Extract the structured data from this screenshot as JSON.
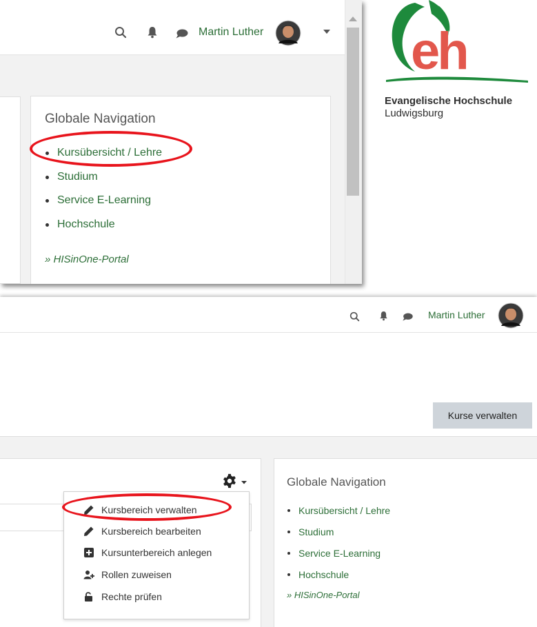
{
  "top_panel": {
    "navbar": {
      "search_icon": "search-icon",
      "notification_icon": "bell-icon",
      "message_icon": "chat-icon",
      "user_name": "Martin Luther",
      "dropdown_icon": "caret-down-icon"
    },
    "global_nav": {
      "title": "Globale Navigation",
      "items": [
        "Kursübersicht / Lehre",
        "Studium",
        "Service E-Learning",
        "Hochschule"
      ],
      "portal_link": "» HISinOne-Portal"
    }
  },
  "logo": {
    "mark_text": "eh",
    "line1": "Evangelische Hochschule",
    "line2": "Ludwigsburg",
    "colors": {
      "green": "#1e8a3c",
      "red": "#e2574c"
    }
  },
  "bottom_panel": {
    "navbar": {
      "search_icon": "search-icon",
      "notification_icon": "bell-icon",
      "message_icon": "chat-icon",
      "user_name": "Martin Luther"
    },
    "manage_courses_button": "Kurse verwalten",
    "settings_menu": {
      "icon": "gear-icon",
      "items": [
        {
          "label": "Kursbereich verwalten",
          "icon": "pencil-icon"
        },
        {
          "label": "Kursbereich bearbeiten",
          "icon": "pencil-icon"
        },
        {
          "label": "Kursunterbereich anlegen",
          "icon": "plus-square-icon"
        },
        {
          "label": "Rollen zuweisen",
          "icon": "user-plus-icon"
        },
        {
          "label": "Rechte prüfen",
          "icon": "unlock-icon"
        }
      ]
    },
    "global_nav": {
      "title": "Globale Navigation",
      "items": [
        "Kursübersicht / Lehre",
        "Studium",
        "Service E-Learning",
        "Hochschule"
      ],
      "portal_link": "» HISinOne-Portal"
    }
  },
  "colors": {
    "link_green": "#2c6e37",
    "highlight_red": "#e8141c",
    "button_gray": "#ced4da",
    "page_gray": "#f2f2f2"
  }
}
